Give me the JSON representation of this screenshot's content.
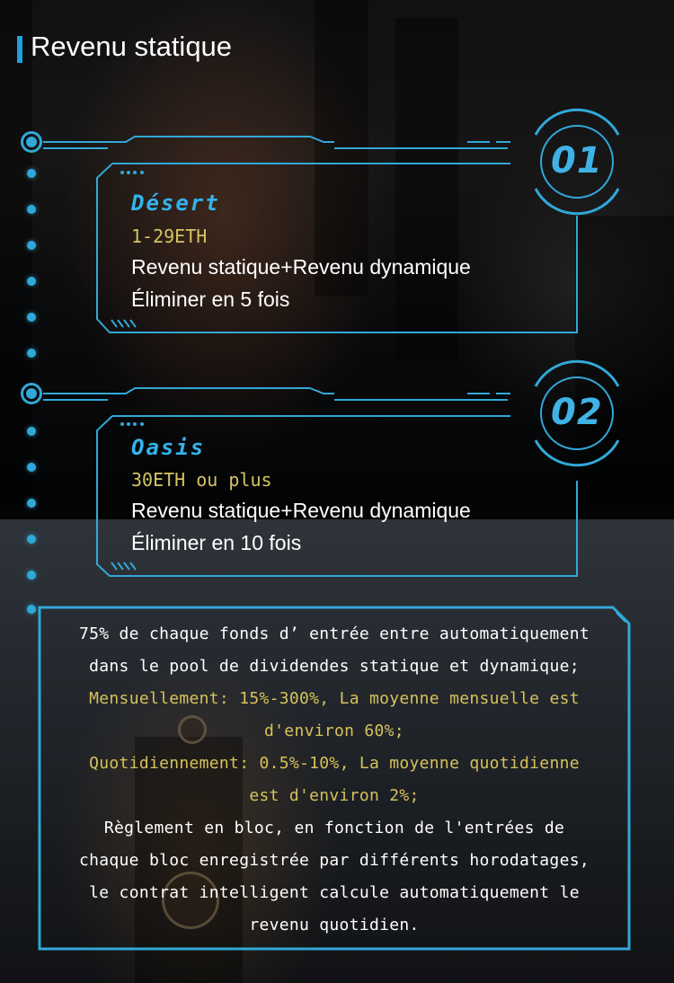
{
  "heading": {
    "title": "Revenu statique"
  },
  "levels": [
    {
      "number": "01",
      "name": "Désert",
      "range": "1-29ETH",
      "line1": "Revenu statique+Revenu dynamique",
      "line2": "Éliminer en 5 fois"
    },
    {
      "number": "02",
      "name": "Oasis",
      "range": "30ETH ou plus",
      "line1": "Revenu statique+Revenu dynamique",
      "line2": "Éliminer en 10 fois"
    }
  ],
  "info": {
    "p1_line1": "75% de chaque fonds d’ entrée entre automatiquement",
    "p1_line2": "dans le pool de dividendes statique et dynamique;",
    "monthly_line1": "Mensuellement: 15%-300%, La moyenne mensuelle est",
    "monthly_line2": "d'environ 60%;",
    "daily_line1": "Quotidiennement: 0.5%-10%, La moyenne quotidienne",
    "daily_line2": "est d'environ 2%;",
    "p3_line1": "Règlement en bloc, en fonction de  l'entrées de",
    "p3_line2": "chaque bloc enregistrée par différents horodatages,",
    "p3_line3": "le contrat intelligent calcule automatiquement le",
    "p3_line4": "revenu quotidien."
  },
  "colors": {
    "accent": "#31a8d8",
    "highlight_text": "#d7c25a",
    "title_bar": "#1da0e0"
  }
}
